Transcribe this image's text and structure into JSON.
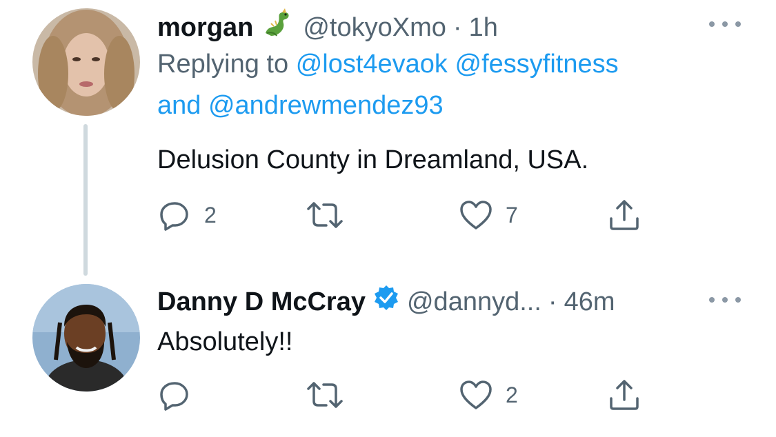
{
  "tweets": [
    {
      "name": "morgan",
      "handle": "@tokyoXmo",
      "dot": "·",
      "time": "1h",
      "replying_prefix": "Replying to",
      "mention1": "@lost4evaok",
      "mention2": "@fessyfitness",
      "and": "and",
      "mention3": "@andrewmendez93",
      "text": "Delusion County in Dreamland, USA.",
      "reply_count": "2",
      "retweet_count": "",
      "like_count": "7",
      "emoji_icon": "dragon-emoji-icon",
      "avatar_bg": "#b59a7e"
    },
    {
      "name": "Danny D McCray",
      "handle": "@dannyd...",
      "dot": "·",
      "time": "46m",
      "text": "Absolutely!!",
      "reply_count": "",
      "retweet_count": "",
      "like_count": "2",
      "verified": true,
      "avatar_bg": "#6a88a5"
    }
  ],
  "colors": {
    "link": "#1d9bf0",
    "muted": "#536471",
    "verified": "#1d9bf0",
    "thread": "#cfd9de"
  }
}
